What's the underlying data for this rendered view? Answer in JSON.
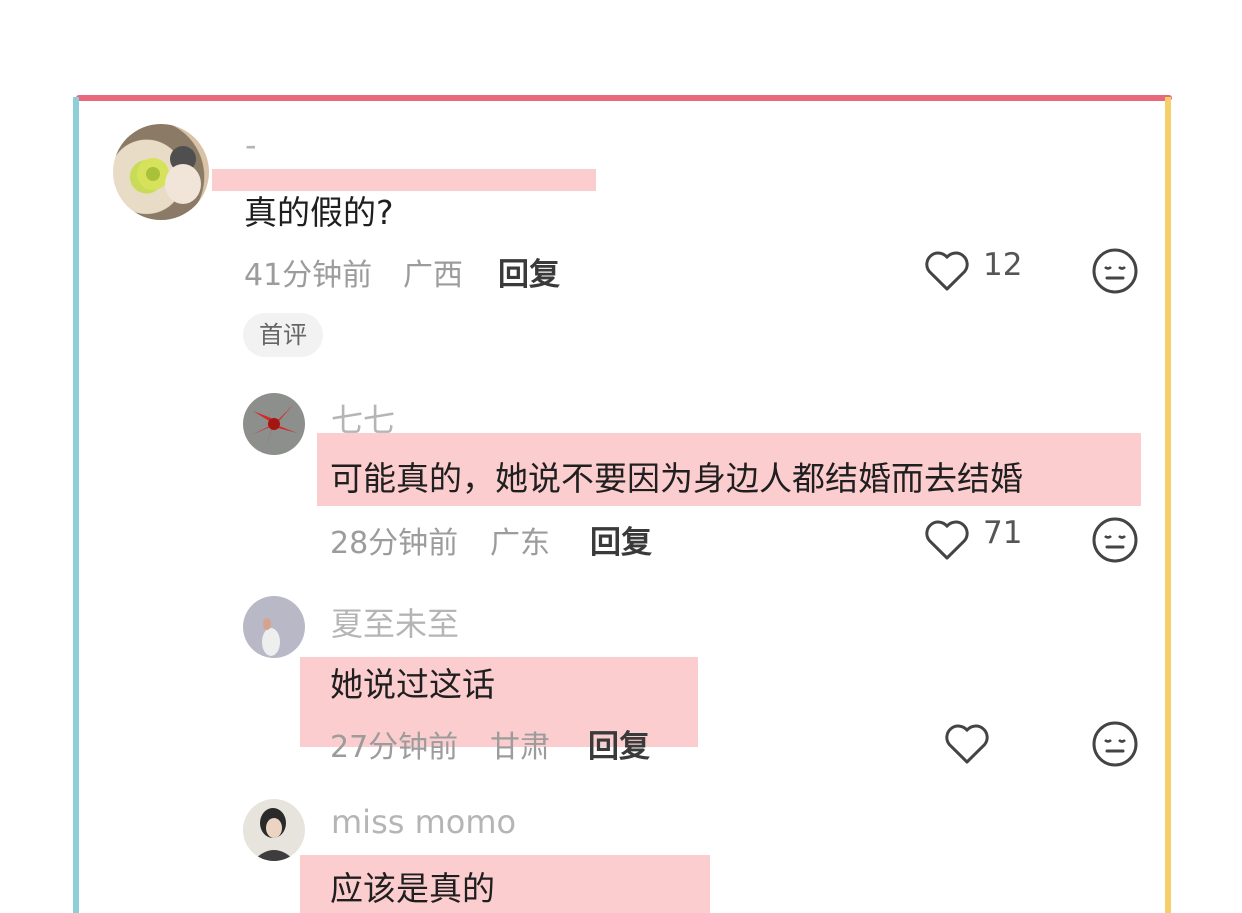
{
  "comments": [
    {
      "username": "-",
      "text": "真的假的?",
      "time": "41分钟前",
      "location": "广西",
      "reply_label": "回复",
      "likes": "12",
      "tag": "首评"
    },
    {
      "username": "七七",
      "text": "可能真的，她说不要因为身边人都结婚而去结婚",
      "time": "28分钟前",
      "location": "广东",
      "reply_label": "回复",
      "likes": "71"
    },
    {
      "username": "夏至未至",
      "text": "她说过这话",
      "time": "27分钟前",
      "location": "甘肃",
      "reply_label": "回复",
      "likes": ""
    },
    {
      "username": "miss momo",
      "text": "应该是真的"
    }
  ],
  "colors": {
    "frame_top": "#e8697c",
    "frame_left": "#8fcfd8",
    "frame_right": "#f4cf6a",
    "highlight": "#faafb2"
  },
  "icons": [
    "heart-icon",
    "dislike-face-icon"
  ]
}
